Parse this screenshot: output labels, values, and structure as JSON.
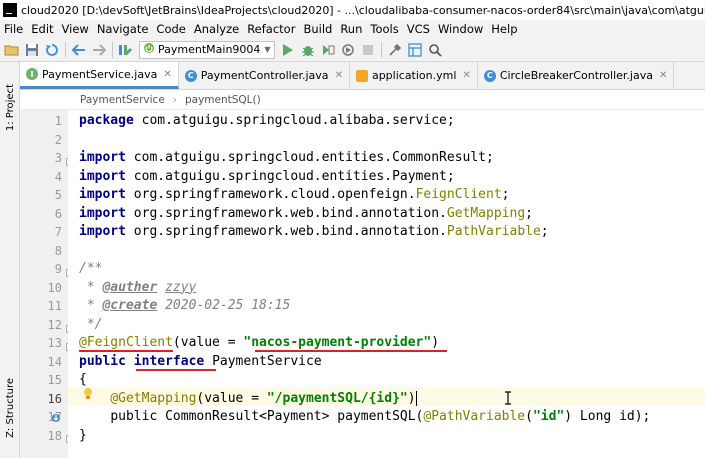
{
  "titlebar": {
    "text": "cloud2020 [D:\\devSoft\\JetBrains\\IdeaProjects\\cloud2020] - ...\\cloudalibaba-consumer-nacos-order84\\src\\main\\java\\com\\atguigu\\springcloud"
  },
  "menu": [
    "File",
    "Edit",
    "View",
    "Navigate",
    "Code",
    "Analyze",
    "Refactor",
    "Build",
    "Run",
    "Tools",
    "VCS",
    "Window",
    "Help"
  ],
  "toolbar": {
    "run_config": "PaymentMain9004",
    "icons": [
      "open-folder-icon",
      "save-icon",
      "sync-icon",
      "back-arrow-icon",
      "forward-arrow-icon",
      "build-icon",
      "run-icon",
      "debug-icon",
      "coverage-icon",
      "stop-icon",
      "project-structure-icon",
      "search-icon"
    ]
  },
  "left_strip": {
    "project_label": "1: Project",
    "structure_label": "Z: Structure"
  },
  "tabs": [
    {
      "label": "PaymentService.java",
      "icon": "I",
      "kind": "iface",
      "active": true
    },
    {
      "label": "PaymentController.java",
      "icon": "C",
      "kind": "cls",
      "active": false
    },
    {
      "label": "application.yml",
      "icon": "",
      "kind": "yml",
      "active": false
    },
    {
      "label": "CircleBreakerController.java",
      "icon": "C",
      "kind": "cls",
      "active": false
    }
  ],
  "breadcrumb": {
    "item1": "PaymentService",
    "item2": "paymentSQL()"
  },
  "editor": {
    "line_numbers": [
      "1",
      "2",
      "3",
      "4",
      "5",
      "6",
      "7",
      "8",
      "9",
      "10",
      "11",
      "12",
      "13",
      "14",
      "15",
      "16",
      "17",
      "18"
    ],
    "current_line": "16",
    "l1": {
      "kw": "package",
      "rest": " com.atguigu.springcloud.alibaba.service;"
    },
    "l3": {
      "kw": "import",
      "rest": " com.atguigu.springcloud.entities.CommonResult;"
    },
    "l4": {
      "kw": "import",
      "rest": " com.atguigu.springcloud.entities.Payment;"
    },
    "l5": {
      "kw": "import",
      "pre": " org.springframework.cloud.openfeign.",
      "cls": "FeignClient",
      "end": ";"
    },
    "l6": {
      "kw": "import",
      "pre": " org.springframework.web.bind.annotation.",
      "cls": "GetMapping",
      "end": ";"
    },
    "l7": {
      "kw": "import",
      "pre": " org.springframework.web.bind.annotation.",
      "cls": "PathVariable",
      "end": ";"
    },
    "l9": {
      "text": "/**"
    },
    "l10": {
      "star": " * ",
      "tag": "@auther",
      "sp": " ",
      "val": "zzyy"
    },
    "l11": {
      "star": " * ",
      "tag": "@create",
      "sp": " ",
      "val": "2020-02-25 18:15"
    },
    "l12": {
      "text": " */"
    },
    "l13": {
      "ann": "@FeignClient",
      "p1": "(value = ",
      "str": "\"nacos-payment-provider\"",
      "p2": ")"
    },
    "l14": {
      "kw1": "public",
      "sp": " ",
      "kw2": "interface",
      "rest": " PaymentService"
    },
    "l15": {
      "text": "{"
    },
    "l16": {
      "indent": "    ",
      "ann": "@GetMapping",
      "p1": "(value = ",
      "str": "\"/paymentSQL/{id}\"",
      "p2": ")"
    },
    "l17": {
      "indent": "    ",
      "pre": "public CommonResult<Payment> paymentSQL(",
      "ann": "@PathVariable",
      "p1": "(",
      "str": "\"id\"",
      "p2": ") Long id);"
    },
    "l18": {
      "text": "}"
    }
  }
}
